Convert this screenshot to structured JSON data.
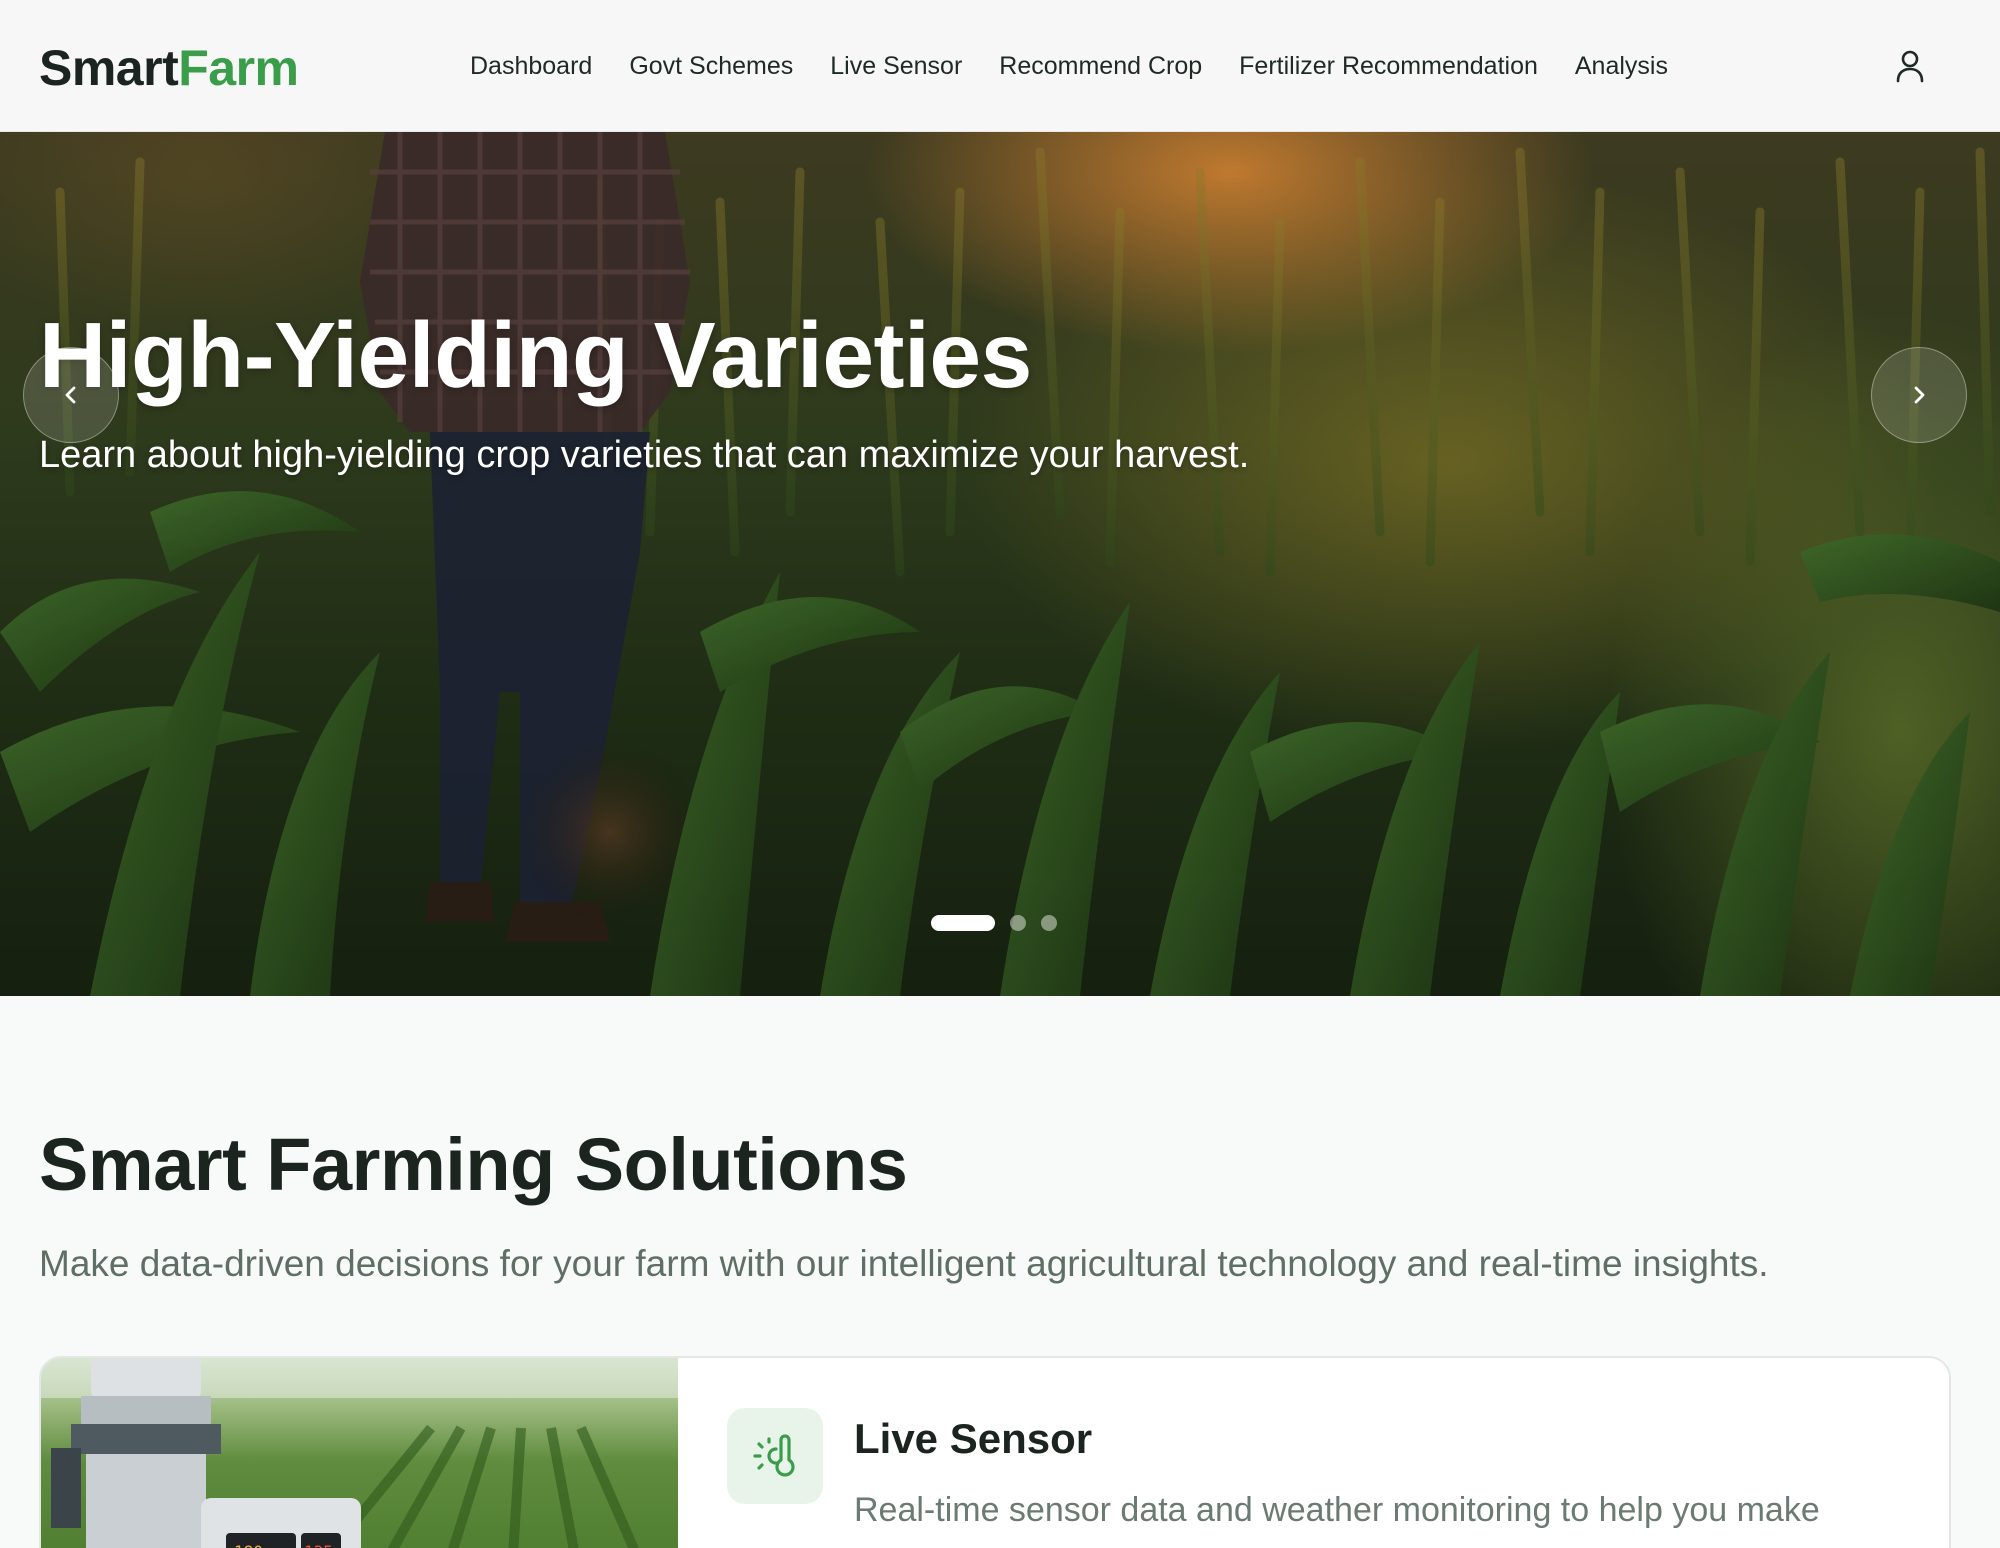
{
  "brand": {
    "part1": "Smart",
    "part2": "Farm"
  },
  "nav": {
    "links": [
      "Dashboard",
      "Govt Schemes",
      "Live Sensor",
      "Recommend Crop",
      "Fertilizer Recommendation",
      "Analysis"
    ],
    "user_icon": "user-icon"
  },
  "hero": {
    "title": "High-Yielding Varieties",
    "subtitle": "Learn about high-yielding crop varieties that can maximize your harvest.",
    "prev_icon": "chevron-left-icon",
    "next_icon": "chevron-right-icon",
    "slide_count": 3,
    "active_slide": 1
  },
  "solutions": {
    "title": "Smart Farming Solutions",
    "subtitle": "Make data-driven decisions for your farm with our intelligent agricultural technology and real-time insights.",
    "cards": [
      {
        "title": "Live Sensor",
        "description": "Real-time sensor data and weather monitoring to help you make informed farming decisions.",
        "icon": "thermometer-sun-icon"
      }
    ]
  },
  "colors": {
    "brand_green": "#3a9d4a",
    "text_dark": "#1c2420",
    "text_muted": "#5f6f66",
    "icon_bg": "#e8f4ea"
  }
}
